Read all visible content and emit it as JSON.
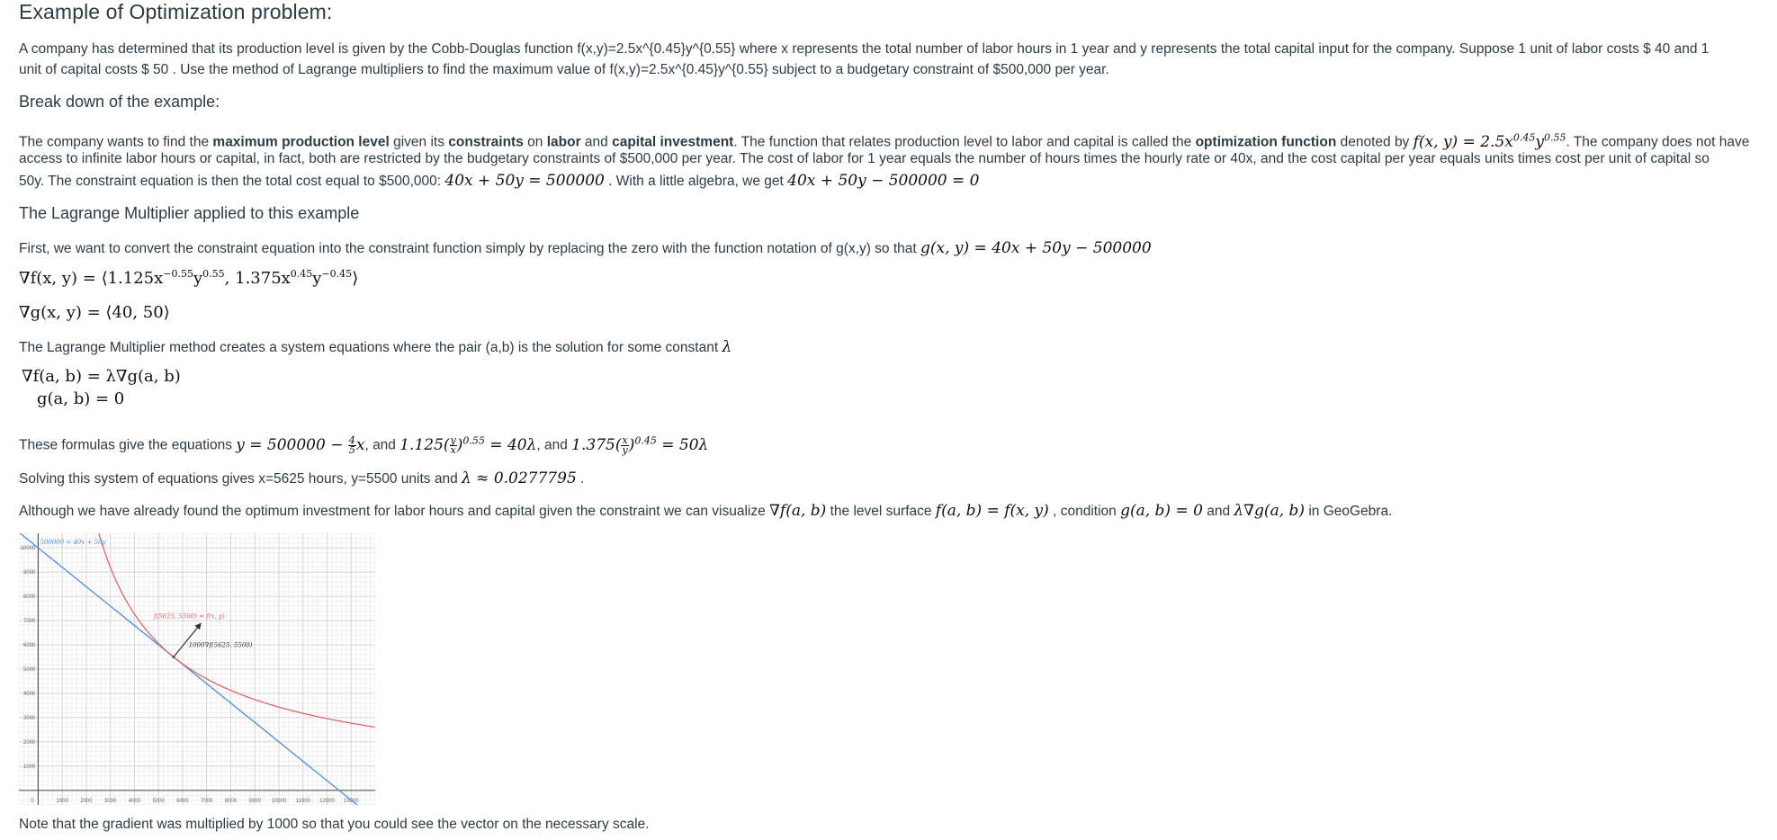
{
  "page_title": "Example of Optimization problem:",
  "intro": {
    "line1": "A company has determined that its production level is given by the Cobb-Douglas function f(x,y)=2.5x^{0.45}y^{0.55} where x represents the total number of labor hours in  1  year and y represents the total capital input for the company. Suppose  1  unit of labor costs  $ 40  and  1",
    "line2": " unit of capital costs  $ 50 .  Use the method of Lagrange multipliers to find the maximum value of f(x,y)=2.5x^{0.45}y^{0.55} subject to a budgetary constraint of $500,000 per year."
  },
  "breakdown": {
    "heading": "Break down of the example:",
    "p1_a": "The company wants to find the ",
    "p1_b1": "maximum production level",
    "p1_c": " given its ",
    "p1_b2": "constraints",
    "p1_d": " on ",
    "p1_b3": "labor",
    "p1_e": " and ",
    "p1_b4": "capital investment",
    "p1_f": ".  The function that relates production level to labor and capital is called the ",
    "p1_b5": "optimization function",
    "p1_g": " denoted by ",
    "p1_math": "f(x, y) = 2.5x",
    "p1_exp1": "0.45",
    "p1_y": "y",
    "p1_exp2": "0.55",
    "p1_h": ".  The company does not have",
    "p2": "access to infinite labor hours or capital, in fact, both are restricted by the budgetary constraints of $500,000 per year.  The cost of labor for 1 year equals the number of hours times the hourly rate or 40x, and the cost capital per year equals units times cost per unit of capital so",
    "p3_a": "50y.  The constraint equation is then the total cost equal to $500,000: ",
    "p3_math1": "40x + 50y = 500000",
    "p3_b": " .  With a little algebra, we get ",
    "p3_math2": "40x + 50y − 500000 = 0"
  },
  "lagrange": {
    "heading": "The Lagrange Multiplier applied to this example",
    "p1_a": "First, we want to convert the constraint equation into the constraint function simply by replacing the zero with the function notation of g(x,y) so that ",
    "p1_math": "g(x, y) = 40x + 50y − 500000",
    "grad_f_a": "∇f(x, y) = ⟨1.125x",
    "grad_f_e1": "−0.55",
    "grad_f_b": "y",
    "grad_f_e2": "0.55",
    "grad_f_c": ", 1.375x",
    "grad_f_e3": "0.45",
    "grad_f_d": "y",
    "grad_f_e4": "−0.45",
    "grad_f_end": "⟩",
    "grad_g": "∇g(x, y) = ⟨40, 50⟩",
    "system_intro": "The Lagrange Multiplier method creates a system equations where the pair (a,b) is the solution for some constant ",
    "lambda": "λ",
    "system_eq1": "∇f(a, b) = λ∇g(a, b)",
    "system_eq2": "g(a, b) = 0",
    "formulas_a": "These formulas give the equations ",
    "formulas_m1": "y = 500000 − ",
    "formulas_frac1_num": "4",
    "formulas_frac1_den": "5",
    "formulas_m1b": "x",
    "formulas_b": ", and ",
    "formulas_m2": "1.125(",
    "formulas_frac2_num": "y",
    "formulas_frac2_den": "x",
    "formulas_m2b": ")",
    "formulas_e2": "0.55",
    "formulas_m2c": " = 40λ",
    "formulas_c": ", and ",
    "formulas_m3": "1.375(",
    "formulas_frac3_num": "x",
    "formulas_frac3_den": "y",
    "formulas_m3b": ")",
    "formulas_e3": "0.45",
    "formulas_m3c": " = 50λ",
    "solving_a": "Solving this system of equations gives x=5625 hours, y=5500 units and ",
    "solving_math": "λ ≈ 0.0277795",
    "solving_b": " .",
    "visual_a": "Although we have already found the optimum investment for labor hours and capital given the constraint we can visualize ",
    "visual_m1": "∇f(a, b)",
    "visual_b": "  the level surface ",
    "visual_m2": "f(a, b) = f(x, y)",
    "visual_c": " , condition ",
    "visual_m3": "g(a, b) = 0",
    "visual_d": " and ",
    "visual_m4": "λ∇g(a, b)",
    "visual_e": "  in GeoGebra."
  },
  "chart_data": {
    "type": "line",
    "title": "",
    "xlabel": "",
    "ylabel": "",
    "xlim": [
      -800,
      14000
    ],
    "ylim": [
      -600,
      10600
    ],
    "grid": true,
    "x_ticks": [
      0,
      1000,
      2000,
      3000,
      4000,
      5000,
      6000,
      7000,
      8000,
      9000,
      10000,
      11000,
      12000,
      13000
    ],
    "y_ticks": [
      1000,
      2000,
      3000,
      4000,
      5000,
      6000,
      7000,
      8000,
      9000,
      10000
    ],
    "series": [
      {
        "name": "500000 = 40x + 50y",
        "kind": "constraint-line",
        "color": "#4a90d9",
        "equation": "y = (500000 - 40x)/50"
      },
      {
        "name": "f(5625, 5500) = f(x, y)",
        "kind": "level-curve",
        "color": "#e06666",
        "equation": "2.5x^0.45 y^0.55 = f(5625,5500)"
      },
      {
        "name": "1000∇f(5625, 5500)",
        "kind": "vector",
        "color": "#333333",
        "from": [
          5625,
          5500
        ],
        "to": [
          6750,
          6875
        ]
      }
    ],
    "optimum": {
      "x": 5625,
      "y": 5500
    }
  },
  "note": "Note that the gradient was multiplied by 1000 so that you could see the vector on the necessary scale."
}
